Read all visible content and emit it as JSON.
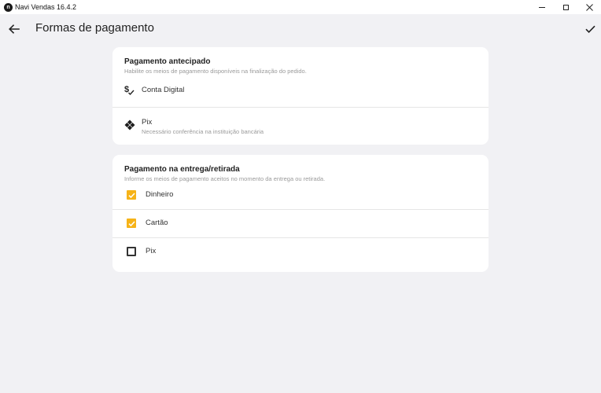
{
  "window": {
    "app_title": "Navi Vendas 16.4.2",
    "logo_glyph": "n",
    "controls": [
      "minimize-icon",
      "maximize-icon",
      "close-icon"
    ]
  },
  "header": {
    "title": "Formas de pagamento",
    "back_icon": "arrow-left-icon",
    "confirm_icon": "check-icon"
  },
  "prepaid": {
    "title": "Pagamento antecipado",
    "subtitle": "Habilite os meios de pagamento disponíveis na finalização do pedido.",
    "items": [
      {
        "label": "Conta Digital",
        "icon": "dollar-check-icon"
      },
      {
        "label": "Pix",
        "sublabel": "Necessário conferência na instituição bancária",
        "icon": "pix-icon"
      }
    ]
  },
  "on_delivery": {
    "title": "Pagamento na entrega/retirada",
    "subtitle": "Informe os meios de pagamento aceitos no momento da entrega ou retirada.",
    "items": [
      {
        "label": "Dinheiro",
        "checked": true
      },
      {
        "label": "Cartão",
        "checked": true
      },
      {
        "label": "Pix",
        "checked": false
      }
    ]
  },
  "colors": {
    "accent": "#f6b318",
    "background": "#f1f1f4",
    "card": "#ffffff"
  }
}
